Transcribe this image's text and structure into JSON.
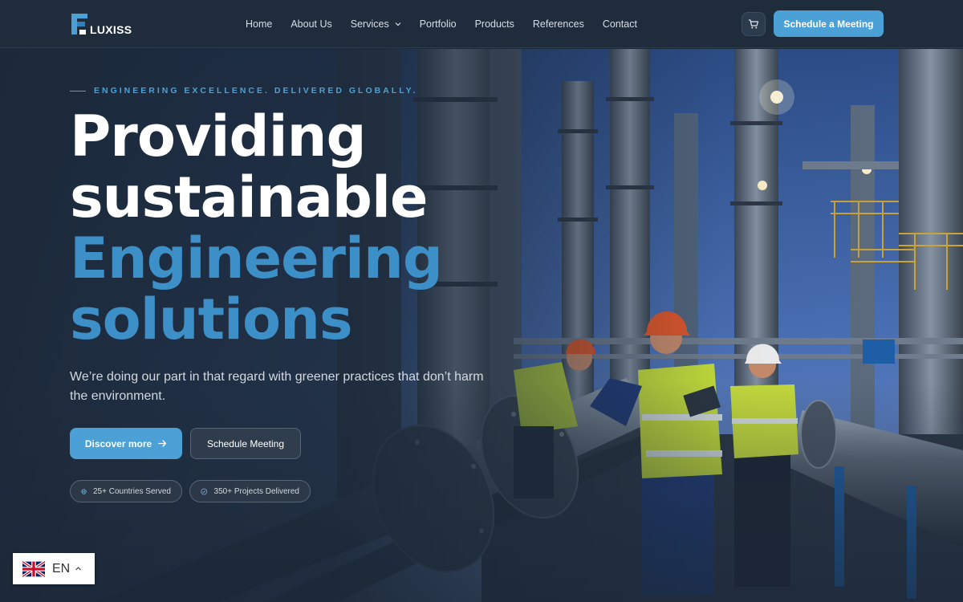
{
  "header": {
    "logo_text": "LUXISS",
    "logo_letter": "F",
    "nav": [
      {
        "label": "Home"
      },
      {
        "label": "About Us"
      },
      {
        "label": "Services",
        "has_dropdown": true
      },
      {
        "label": "Portfolio"
      },
      {
        "label": "Products"
      },
      {
        "label": "References"
      },
      {
        "label": "Contact"
      }
    ],
    "cart_icon": "cart-icon",
    "cta_label": "Schedule a Meeting"
  },
  "hero": {
    "eyebrow": "ENGINEERING EXCELLENCE. DELIVERED GLOBALLY.",
    "headline": {
      "line1": "Providing",
      "line2": "sustainable",
      "line3": "Engineering",
      "line4": "solutions"
    },
    "subtext": "We’re doing our part in that regard with greener practices that don’t harm the environment.",
    "primary_button": "Discover more",
    "secondary_button": "Schedule Meeting",
    "stats": [
      {
        "icon": "globe-icon",
        "label": "25+ Countries Served"
      },
      {
        "icon": "check-circle-icon",
        "label": "350+ Projects Delivered"
      }
    ]
  },
  "language": {
    "flag": "uk-flag-icon",
    "code": "EN"
  },
  "colors": {
    "accent": "#4ba1d6",
    "headline_blue": "#3d8fc7",
    "header_bg": "#1f2c3b"
  }
}
